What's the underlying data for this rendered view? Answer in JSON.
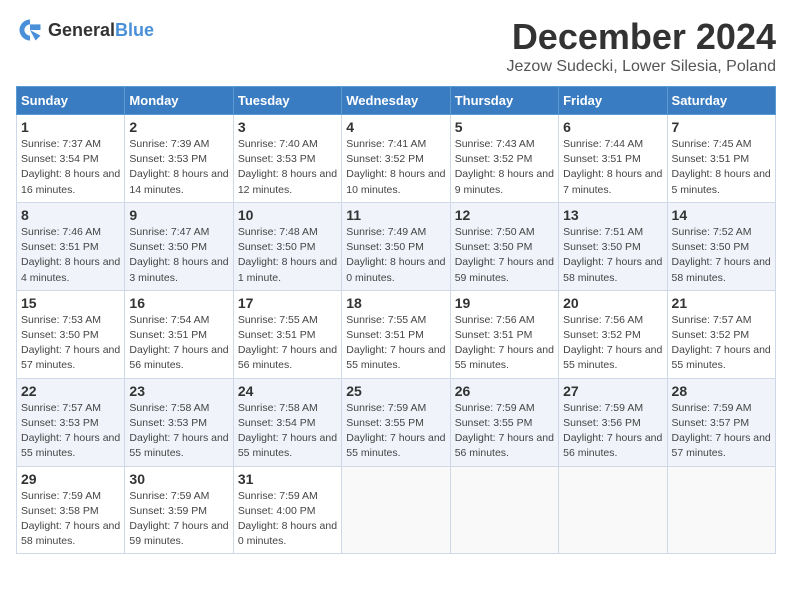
{
  "header": {
    "logo_general": "General",
    "logo_blue": "Blue",
    "month_title": "December 2024",
    "location": "Jezow Sudecki, Lower Silesia, Poland"
  },
  "days_of_week": [
    "Sunday",
    "Monday",
    "Tuesday",
    "Wednesday",
    "Thursday",
    "Friday",
    "Saturday"
  ],
  "weeks": [
    [
      {
        "day": "1",
        "sunrise": "7:37 AM",
        "sunset": "3:54 PM",
        "daylight": "8 hours and 16 minutes."
      },
      {
        "day": "2",
        "sunrise": "7:39 AM",
        "sunset": "3:53 PM",
        "daylight": "8 hours and 14 minutes."
      },
      {
        "day": "3",
        "sunrise": "7:40 AM",
        "sunset": "3:53 PM",
        "daylight": "8 hours and 12 minutes."
      },
      {
        "day": "4",
        "sunrise": "7:41 AM",
        "sunset": "3:52 PM",
        "daylight": "8 hours and 10 minutes."
      },
      {
        "day": "5",
        "sunrise": "7:43 AM",
        "sunset": "3:52 PM",
        "daylight": "8 hours and 9 minutes."
      },
      {
        "day": "6",
        "sunrise": "7:44 AM",
        "sunset": "3:51 PM",
        "daylight": "8 hours and 7 minutes."
      },
      {
        "day": "7",
        "sunrise": "7:45 AM",
        "sunset": "3:51 PM",
        "daylight": "8 hours and 5 minutes."
      }
    ],
    [
      {
        "day": "8",
        "sunrise": "7:46 AM",
        "sunset": "3:51 PM",
        "daylight": "8 hours and 4 minutes."
      },
      {
        "day": "9",
        "sunrise": "7:47 AM",
        "sunset": "3:50 PM",
        "daylight": "8 hours and 3 minutes."
      },
      {
        "day": "10",
        "sunrise": "7:48 AM",
        "sunset": "3:50 PM",
        "daylight": "8 hours and 1 minute."
      },
      {
        "day": "11",
        "sunrise": "7:49 AM",
        "sunset": "3:50 PM",
        "daylight": "8 hours and 0 minutes."
      },
      {
        "day": "12",
        "sunrise": "7:50 AM",
        "sunset": "3:50 PM",
        "daylight": "7 hours and 59 minutes."
      },
      {
        "day": "13",
        "sunrise": "7:51 AM",
        "sunset": "3:50 PM",
        "daylight": "7 hours and 58 minutes."
      },
      {
        "day": "14",
        "sunrise": "7:52 AM",
        "sunset": "3:50 PM",
        "daylight": "7 hours and 58 minutes."
      }
    ],
    [
      {
        "day": "15",
        "sunrise": "7:53 AM",
        "sunset": "3:50 PM",
        "daylight": "7 hours and 57 minutes."
      },
      {
        "day": "16",
        "sunrise": "7:54 AM",
        "sunset": "3:51 PM",
        "daylight": "7 hours and 56 minutes."
      },
      {
        "day": "17",
        "sunrise": "7:55 AM",
        "sunset": "3:51 PM",
        "daylight": "7 hours and 56 minutes."
      },
      {
        "day": "18",
        "sunrise": "7:55 AM",
        "sunset": "3:51 PM",
        "daylight": "7 hours and 55 minutes."
      },
      {
        "day": "19",
        "sunrise": "7:56 AM",
        "sunset": "3:51 PM",
        "daylight": "7 hours and 55 minutes."
      },
      {
        "day": "20",
        "sunrise": "7:56 AM",
        "sunset": "3:52 PM",
        "daylight": "7 hours and 55 minutes."
      },
      {
        "day": "21",
        "sunrise": "7:57 AM",
        "sunset": "3:52 PM",
        "daylight": "7 hours and 55 minutes."
      }
    ],
    [
      {
        "day": "22",
        "sunrise": "7:57 AM",
        "sunset": "3:53 PM",
        "daylight": "7 hours and 55 minutes."
      },
      {
        "day": "23",
        "sunrise": "7:58 AM",
        "sunset": "3:53 PM",
        "daylight": "7 hours and 55 minutes."
      },
      {
        "day": "24",
        "sunrise": "7:58 AM",
        "sunset": "3:54 PM",
        "daylight": "7 hours and 55 minutes."
      },
      {
        "day": "25",
        "sunrise": "7:59 AM",
        "sunset": "3:55 PM",
        "daylight": "7 hours and 55 minutes."
      },
      {
        "day": "26",
        "sunrise": "7:59 AM",
        "sunset": "3:55 PM",
        "daylight": "7 hours and 56 minutes."
      },
      {
        "day": "27",
        "sunrise": "7:59 AM",
        "sunset": "3:56 PM",
        "daylight": "7 hours and 56 minutes."
      },
      {
        "day": "28",
        "sunrise": "7:59 AM",
        "sunset": "3:57 PM",
        "daylight": "7 hours and 57 minutes."
      }
    ],
    [
      {
        "day": "29",
        "sunrise": "7:59 AM",
        "sunset": "3:58 PM",
        "daylight": "7 hours and 58 minutes."
      },
      {
        "day": "30",
        "sunrise": "7:59 AM",
        "sunset": "3:59 PM",
        "daylight": "7 hours and 59 minutes."
      },
      {
        "day": "31",
        "sunrise": "7:59 AM",
        "sunset": "4:00 PM",
        "daylight": "8 hours and 0 minutes."
      },
      null,
      null,
      null,
      null
    ]
  ]
}
